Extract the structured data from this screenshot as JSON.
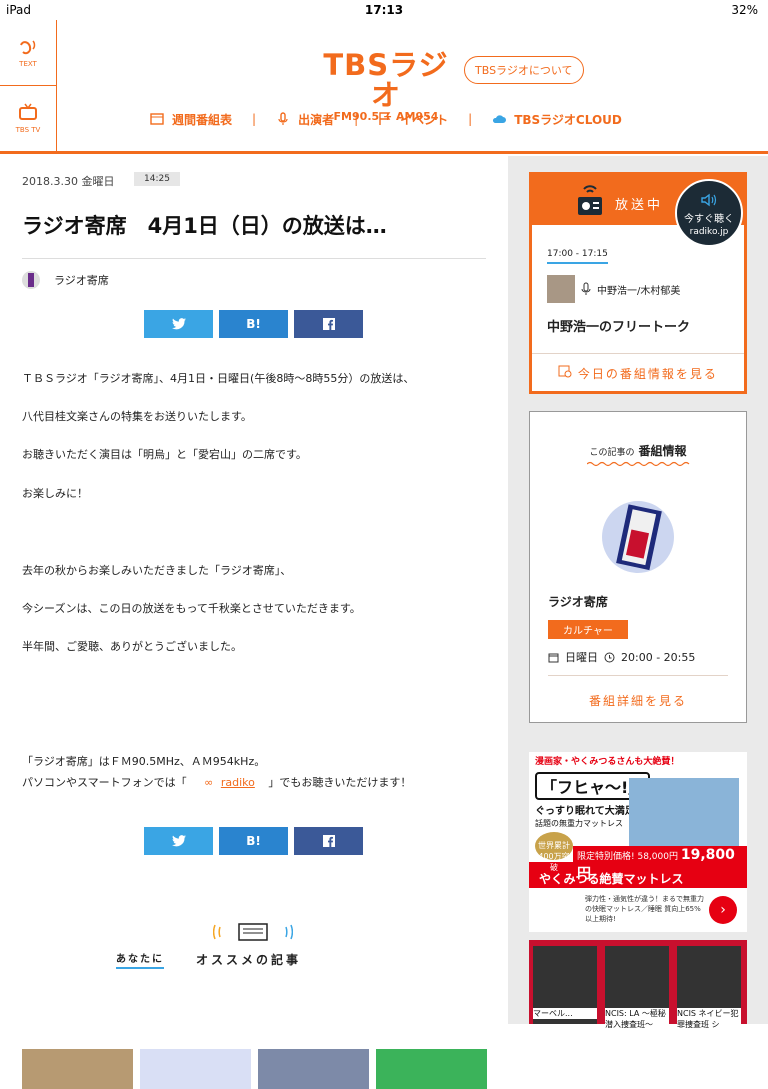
{
  "status": {
    "left": "iPad",
    "time": "17:13",
    "battery": "32%"
  },
  "header": {
    "sidenav": [
      {
        "label": "TEXT",
        "icon": "ear-icon"
      },
      {
        "label": "TBS TV",
        "icon": "tv-icon"
      }
    ],
    "logo": {
      "name": "TBSラジオ",
      "freq": "FM90.5 + AM954"
    },
    "about": "TBSラジオについて",
    "nav": [
      {
        "label": "週間番組表",
        "icon": "schedule-icon"
      },
      {
        "label": "出演者",
        "icon": "mic-icon"
      },
      {
        "label": "イベント",
        "icon": "flag-icon"
      },
      {
        "label": "TBSラジオCLOUD",
        "icon": "cloud-icon"
      }
    ]
  },
  "article": {
    "date": "2018.3.30 金曜日",
    "time": "14:25",
    "title": "ラジオ寄席　4月1日（日）の放送は…",
    "author": "ラジオ寄席",
    "share": {
      "twitter": "",
      "hatena": "B!",
      "facebook": ""
    },
    "paragraphs": [
      "ＴＢＳラジオ「ラジオ寄席」、4月1日・日曜日(午後8時〜8時55分）の放送は、",
      "八代目桂文楽さんの特集をお送りいたします。",
      "お聴きいただく演目は「明烏」と「愛宕山」の二席です。",
      "お楽しみに！",
      "去年の秋からお楽しみいただきました「ラジオ寄席」、",
      "今シーズンは、この日の放送をもって千秋楽とさせていただきます。",
      "半年間、ご愛聴、ありがとうございました。",
      "「ラジオ寄席」はＦＭ90.5MHz、ＡＭ954kHz。"
    ],
    "last_line": {
      "before": "パソコンやスマートフォンでは「",
      "link": "radiko",
      "after": "」でもお聴きいただけます！"
    }
  },
  "reco": {
    "label1": "あなたに",
    "label2": "オススメの記事"
  },
  "onair": {
    "title": "放送中",
    "listen": "今すぐ聴く",
    "listen_sub": "radiko.jp",
    "slot": "17:00 - 17:15",
    "hosts": "中野浩一/木村郁美",
    "program": "中野浩一のフリートーク",
    "link": "今日の番組情報を見る"
  },
  "info": {
    "head_small": "この記事の",
    "head": "番組情報",
    "name": "ラジオ寄席",
    "category": "カルチャー",
    "day": "日曜日",
    "hours": "20:00 - 20:55",
    "link": "番組詳細を見る"
  },
  "ad1": {
    "band": "漫画家・やくみつるさんも大絶賛！",
    "big": "「フヒャ〜!」",
    "sub": "ぐっすり眠れて大満足!",
    "sub2": "話題の無重力マットレス",
    "badge": "世界累計400万突破",
    "price_label": "限定特別価格! 58,000円",
    "price": "19,800円",
    "caption": "やくみつる絶賛マットレス",
    "small": "弾力性・通気性が違う！まるで無重力の快眠マットレス／睡眠 質向上65%以上期待!"
  },
  "ad2": {
    "captions": [
      "マーベル...",
      "NCIS: LA 〜極秘潜入捜査班〜",
      "NCIS ネイビー犯罪捜査班 シ"
    ]
  }
}
